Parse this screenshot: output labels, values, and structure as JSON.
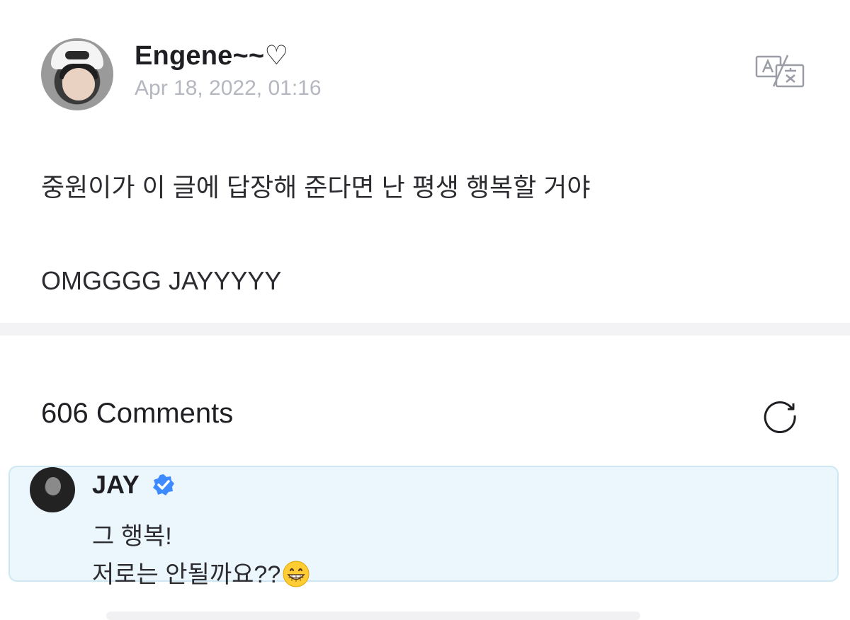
{
  "post": {
    "author": "Engene~~♡",
    "date": "Apr 18, 2022, 01:16",
    "lines": [
      "중원이가 이 글에 답장해 준다면 난 평생 행복할 거야",
      "OMGGGG JAYYYYY"
    ]
  },
  "header_icons": {
    "translate": "translate-icon"
  },
  "comments": {
    "title": "606 Comments",
    "refresh_icon": "refresh-icon",
    "items": [
      {
        "author": "JAY",
        "verified": true,
        "lines": [
          "그 행복!",
          "저로는 안될까요??"
        ],
        "emoji": "grinning-face-icon"
      }
    ]
  },
  "colors": {
    "accent_verified": "#3d8bff",
    "comment_highlight_bg": "#ebf7fd",
    "date_gray": "#b4b7bf"
  }
}
